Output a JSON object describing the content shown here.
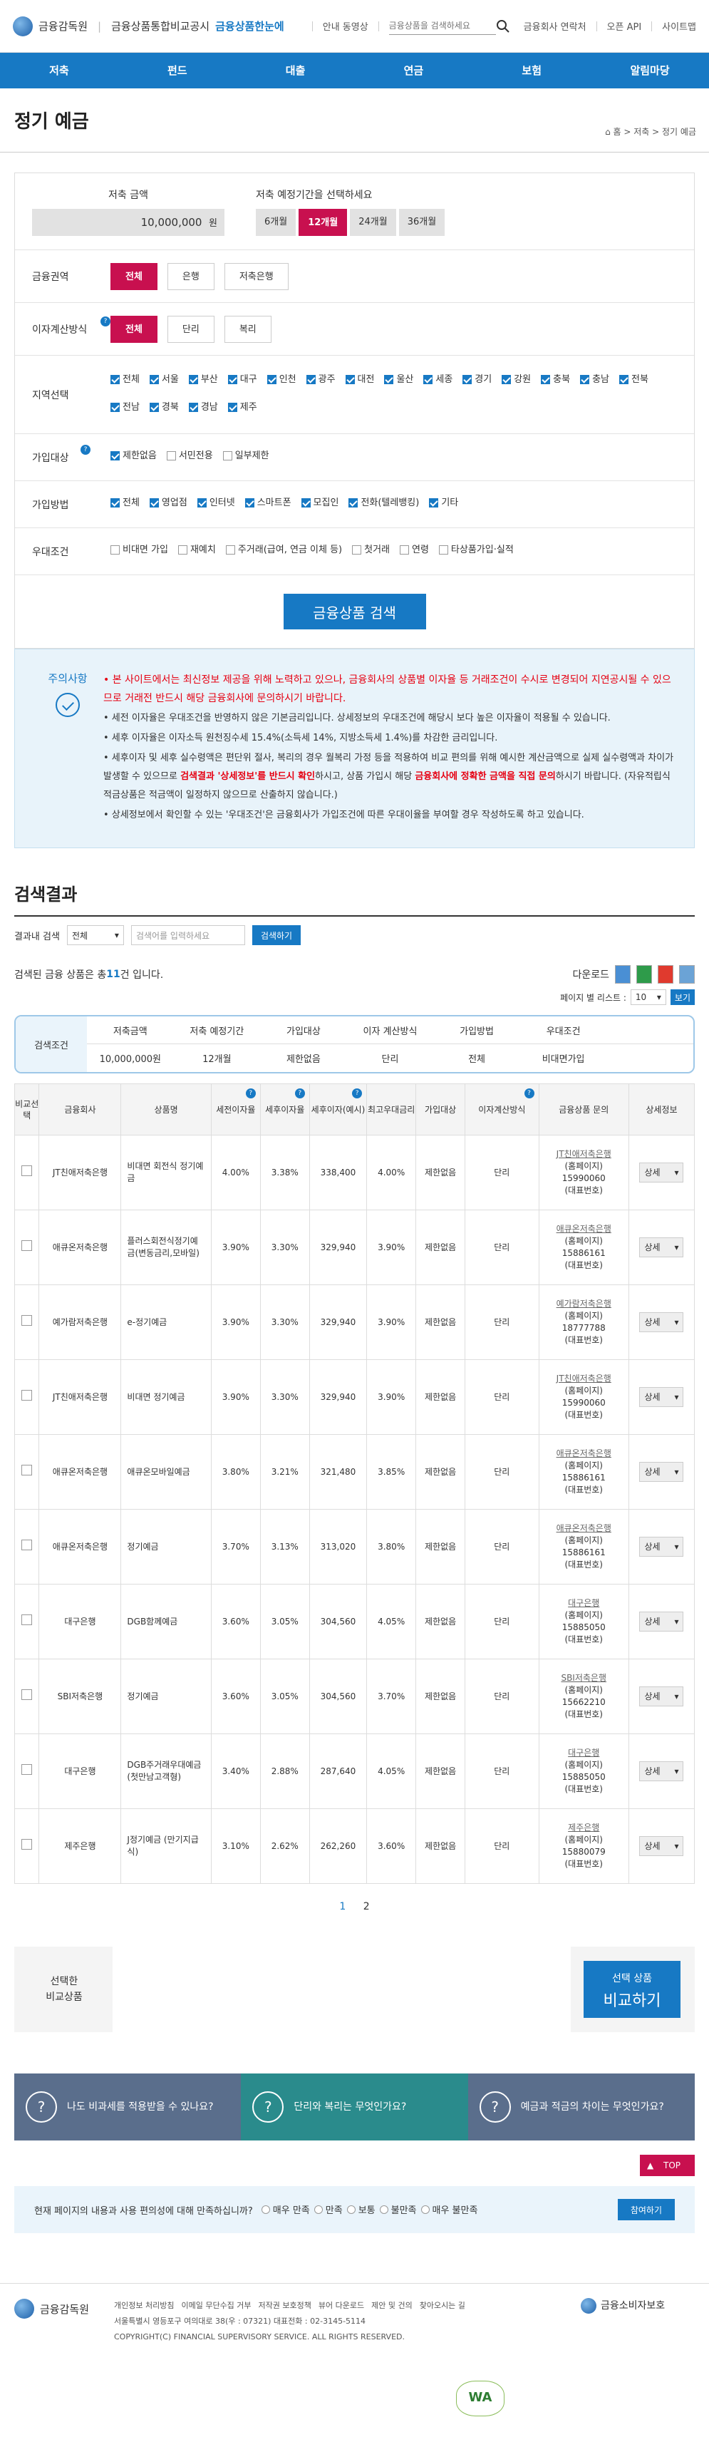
{
  "header": {
    "org": "금융감독원",
    "portal": "금융상품통합비교공시",
    "eye": "금융상품한눈에",
    "guide": "안내 동영상",
    "search_placeholder": "금융상품을 검색하세요",
    "links": [
      "금융회사 연락처",
      "오픈 API",
      "사이트맵"
    ]
  },
  "nav": [
    "저축",
    "펀드",
    "대출",
    "연금",
    "보험",
    "알림마당"
  ],
  "page": {
    "title": "정기 예금",
    "breadcrumb": "홈 > 저축 > 정기 예금"
  },
  "form": {
    "amount_label": "저축 금액",
    "amount": "10,000,000",
    "amount_unit": "원",
    "period_label": "저축 예정기간을 선택하세요",
    "periods": [
      "6개월",
      "12개월",
      "24개월",
      "36개월"
    ],
    "sector_label": "금융권역",
    "sectors": [
      "전체",
      "은행",
      "저축은행"
    ],
    "interest_label": "이자계산방식",
    "interest": [
      "전체",
      "단리",
      "복리"
    ],
    "region_label": "지역선택",
    "regions1": [
      "전체",
      "서울",
      "부산",
      "대구",
      "인천",
      "광주",
      "대전",
      "울산",
      "세종",
      "경기",
      "강원",
      "충북",
      "충남",
      "전북"
    ],
    "regions2": [
      "전남",
      "경북",
      "경남",
      "제주"
    ],
    "target_label": "가입대상",
    "targets": [
      "제한없음",
      "서민전용",
      "일부제한"
    ],
    "method_label": "가입방법",
    "methods": [
      "전체",
      "영업점",
      "인터넷",
      "스마트폰",
      "모집인",
      "전화(텔레뱅킹)",
      "기타"
    ],
    "pref_label": "우대조건",
    "prefs": [
      "비대면 가입",
      "재예치",
      "주거래(급여, 연금 이체 등)",
      "첫거래",
      "연령",
      "타상품가입·실적"
    ],
    "search_btn": "금융상품 검색"
  },
  "notice": {
    "label": "주의사항",
    "l1a": "• 본 사이트에서는 최신정보 제공을 위해 노력하고 있으나, 금융회사의 상품별 이자율 등 거래조건이 수시로 변경되어 지연공시될 수 있으므로 거래전 반드시 해당 금융회사에 문의하시기 바랍니다.",
    "l2": "• 세전 이자율은 우대조건을 반영하지 않은 기본금리입니다. 상세정보의 우대조건에 해당시 보다 높은 이자율이 적용될 수 있습니다.",
    "l3": "• 세후 이자율은 이자소득 원천징수세 15.4%(소득세 14%, 지방소득세 1.4%)를 차감한 금리입니다.",
    "l4a": "• 세후이자 및 세후 실수령액은 편단위 절사, 복리의 경우 월복리 가정 등을 적용하여 비교 편의를 위해 예시한 계산금액으로 실제 실수령액과 차이가 발생할 수 있으므로 ",
    "l4b": "검색결과 '상세정보'를 반드시 확인",
    "l4c": "하시고, 상품 가입시 해당 ",
    "l4d": "금융회사에 정확한 금액을 직접 문의",
    "l4e": "하시기 바랍니다. (자유적립식 적금상품은 적금액이 일정하지 않으므로 산출하지 않습니다.)",
    "l5": "• 상세정보에서 확인할 수 있는 '우대조건'은 금융회사가 가입조건에 따른 우대이율을 부여할 경우 작성하도록 하고 있습니다."
  },
  "results": {
    "title": "검색결과",
    "filter_label": "결과내 검색",
    "filter_select": "전체",
    "filter_placeholder": "검색어를 입력하세요",
    "filter_btn": "검색하기",
    "count_pre": "검색된 금융 상품은 총 ",
    "count": "11",
    "count_post": " 건 입니다.",
    "download": "다운로드",
    "perpage_label": "페이지 별 리스트 :",
    "perpage": "10",
    "perpage_btn": "보기",
    "cond_label": "검색조건",
    "cond_heads": [
      "저축금액",
      "저축 예정기간",
      "가입대상",
      "이자 계산방식",
      "가입방법",
      "우대조건"
    ],
    "cond_vals": [
      "10,000,000원",
      "12개월",
      "제한없음",
      "단리",
      "전체",
      "비대면가입"
    ],
    "cols": [
      "비교선택",
      "금융회사",
      "상품명",
      "세전이자율",
      "세후이자율",
      "세후이자(예시)",
      "최고우대금리",
      "가입대상",
      "이자계산방식",
      "금융상품 문의",
      "상세정보"
    ],
    "rows": [
      {
        "bank": "JT친애저축은행",
        "prod": "비대면 회전식 정기예금",
        "pre": "4.00%",
        "post": "3.38%",
        "int": "338,400",
        "max": "4.00%",
        "tgt": "제한없음",
        "calc": "단리",
        "inq1": "JT친애저축은행",
        "inq2": "(홈페이지)",
        "inq3": "15990060",
        "inq4": "(대표번호)"
      },
      {
        "bank": "애큐온저축은행",
        "prod": "플러스회전식정기예금(변동금리,모바일)",
        "pre": "3.90%",
        "post": "3.30%",
        "int": "329,940",
        "max": "3.90%",
        "tgt": "제한없음",
        "calc": "단리",
        "inq1": "애큐온저축은행",
        "inq2": "(홈페이지)",
        "inq3": "15886161",
        "inq4": "(대표번호)"
      },
      {
        "bank": "예가람저축은행",
        "prod": "e-정기예금",
        "pre": "3.90%",
        "post": "3.30%",
        "int": "329,940",
        "max": "3.90%",
        "tgt": "제한없음",
        "calc": "단리",
        "inq1": "예가람저축은행",
        "inq2": "(홈페이지)",
        "inq3": "18777788",
        "inq4": "(대표번호)"
      },
      {
        "bank": "JT친애저축은행",
        "prod": "비대면 정기예금",
        "pre": "3.90%",
        "post": "3.30%",
        "int": "329,940",
        "max": "3.90%",
        "tgt": "제한없음",
        "calc": "단리",
        "inq1": "JT친애저축은행",
        "inq2": "(홈페이지)",
        "inq3": "15990060",
        "inq4": "(대표번호)"
      },
      {
        "bank": "애큐온저축은행",
        "prod": "애큐온모바일예금",
        "pre": "3.80%",
        "post": "3.21%",
        "int": "321,480",
        "max": "3.85%",
        "tgt": "제한없음",
        "calc": "단리",
        "inq1": "애큐온저축은행",
        "inq2": "(홈페이지)",
        "inq3": "15886161",
        "inq4": "(대표번호)"
      },
      {
        "bank": "애큐온저축은행",
        "prod": "정기예금",
        "pre": "3.70%",
        "post": "3.13%",
        "int": "313,020",
        "max": "3.80%",
        "tgt": "제한없음",
        "calc": "단리",
        "inq1": "애큐온저축은행",
        "inq2": "(홈페이지)",
        "inq3": "15886161",
        "inq4": "(대표번호)"
      },
      {
        "bank": "대구은행",
        "prod": "DGB함께예금",
        "pre": "3.60%",
        "post": "3.05%",
        "int": "304,560",
        "max": "4.05%",
        "tgt": "제한없음",
        "calc": "단리",
        "inq1": "대구은행",
        "inq2": "(홈페이지)",
        "inq3": "15885050",
        "inq4": "(대표번호)"
      },
      {
        "bank": "SBI저축은행",
        "prod": "정기예금",
        "pre": "3.60%",
        "post": "3.05%",
        "int": "304,560",
        "max": "3.70%",
        "tgt": "제한없음",
        "calc": "단리",
        "inq1": "SBI저축은행",
        "inq2": "(홈페이지)",
        "inq3": "15662210",
        "inq4": "(대표번호)"
      },
      {
        "bank": "대구은행",
        "prod": "DGB주거래우대예금(첫만남고객형)",
        "pre": "3.40%",
        "post": "2.88%",
        "int": "287,640",
        "max": "4.05%",
        "tgt": "제한없음",
        "calc": "단리",
        "inq1": "대구은행",
        "inq2": "(홈페이지)",
        "inq3": "15885050",
        "inq4": "(대표번호)"
      },
      {
        "bank": "제주은행",
        "prod": "J정기예금 (만기지급식)",
        "pre": "3.10%",
        "post": "2.62%",
        "int": "262,260",
        "max": "3.60%",
        "tgt": "제한없음",
        "calc": "단리",
        "inq1": "제주은행",
        "inq2": "(홈페이지)",
        "inq3": "15880079",
        "inq4": "(대표번호)"
      }
    ],
    "detail": "상세",
    "pages": [
      "1",
      "2"
    ]
  },
  "compare": {
    "label1": "선택한",
    "label2": "비교상품",
    "btn1": "선택 상품",
    "btn2": "비교하기"
  },
  "faq": [
    "나도 비과세를 적용받을 수 있나요?",
    "단리와 복리는 무엇인가요?",
    "예금과 적금의 차이는 무엇인가요?"
  ],
  "faq_colors": [
    "#5a6e8c",
    "#2a8b8c",
    "#5a6e8c"
  ],
  "top": "TOP",
  "survey": {
    "q": "현재 페이지의 내용과 사용 편의성에 대해 만족하십니까?",
    "opts": [
      "매우 만족",
      "만족",
      "보통",
      "불만족",
      "매우 불만족"
    ],
    "btn": "참여하기"
  },
  "footer": {
    "org": "금융감독원",
    "links": [
      "개인정보 처리방침",
      "이메일 무단수집 거부",
      "저작권 보호정책",
      "뷰어 다운로드",
      "제안 및 건의",
      "찾아오시는 길"
    ],
    "addr": "서울특별시 영등포구 여의대로 38(우 : 07321)   대표전화 : 02-3145-5114",
    "copy": "COPYRIGHT(C) FINANCIAL SUPERVISORY SERVICE. ALL RIGHTS RESERVED.",
    "consumer": "금융소비자보호",
    "wa": "WA"
  },
  "colors": {
    "primary": "#1779c4",
    "accent": "#c8104f"
  }
}
